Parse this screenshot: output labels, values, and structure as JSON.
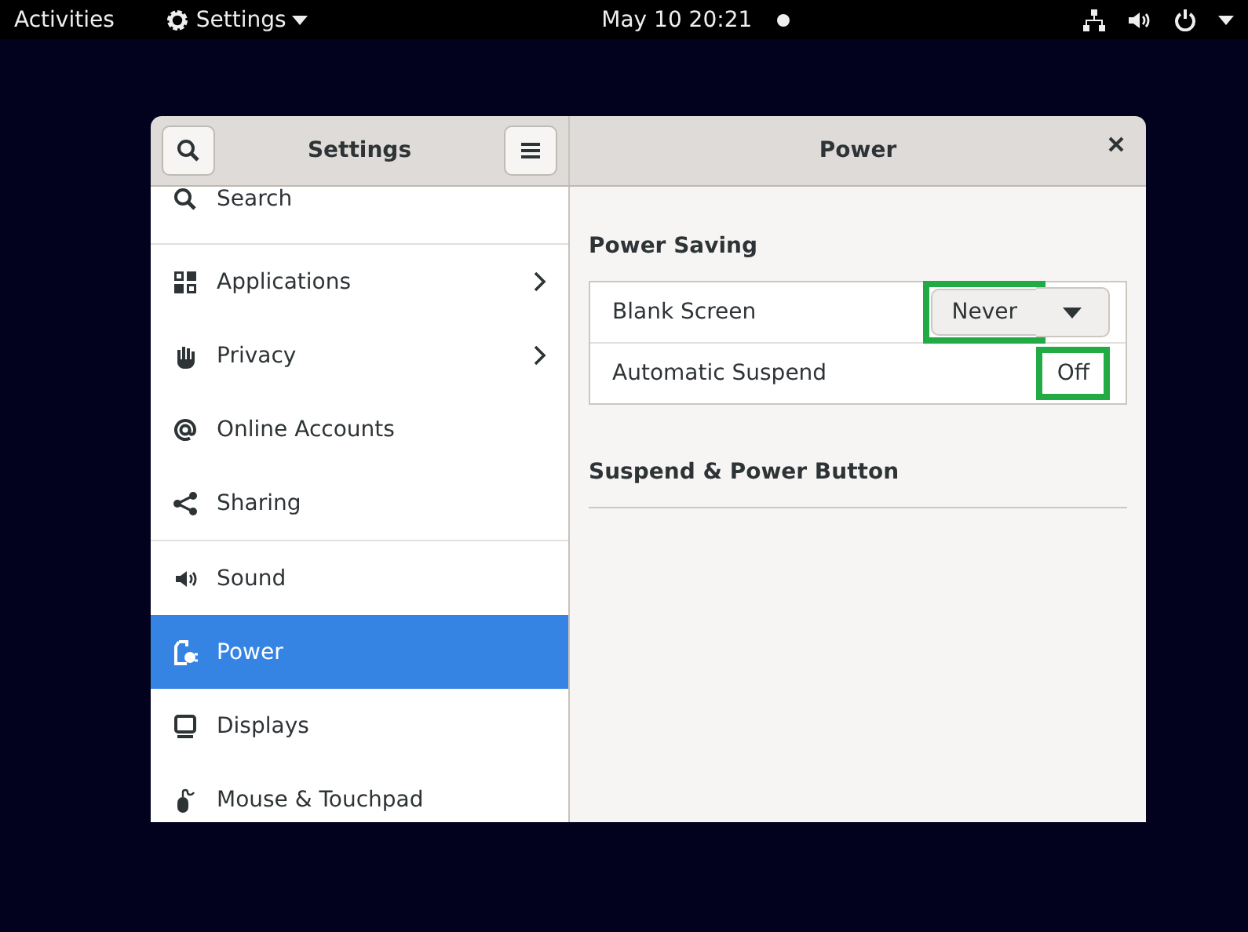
{
  "top_bar": {
    "activities": "Activities",
    "app_menu": "Settings",
    "clock": "May 10  20:21",
    "notification_dot": true
  },
  "window": {
    "sidebar_title": "Settings",
    "panel_title": "Power",
    "sidebar": {
      "sections": [
        {
          "items": [
            {
              "label": "Search",
              "submenu": false,
              "selected": false
            }
          ]
        },
        {
          "items": [
            {
              "label": "Applications",
              "submenu": true,
              "selected": false
            },
            {
              "label": "Privacy",
              "submenu": true,
              "selected": false
            },
            {
              "label": "Online Accounts",
              "submenu": false,
              "selected": false
            },
            {
              "label": "Sharing",
              "submenu": false,
              "selected": false
            }
          ]
        },
        {
          "items": [
            {
              "label": "Sound",
              "submenu": false,
              "selected": false
            },
            {
              "label": "Power",
              "submenu": false,
              "selected": true
            },
            {
              "label": "Displays",
              "submenu": false,
              "selected": false
            },
            {
              "label": "Mouse & Touchpad",
              "submenu": false,
              "selected": false
            }
          ]
        }
      ]
    },
    "panel": {
      "sections": [
        {
          "heading": "Power Saving",
          "rows": [
            {
              "kind": "dropdown",
              "label": "Blank Screen",
              "value": "Never",
              "highlighted": true
            },
            {
              "kind": "value",
              "label": "Automatic Suspend",
              "value": "Off",
              "highlighted": true
            }
          ]
        },
        {
          "heading": "Suspend & Power Button"
        }
      ]
    }
  }
}
